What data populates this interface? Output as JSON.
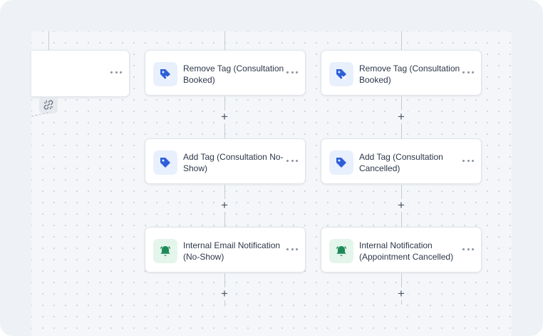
{
  "colors": {
    "frame_background": "#eef1f5",
    "canvas_background": "#f4f6f9",
    "tag_icon_color": "#2f5fd8",
    "tag_icon_background": "#e8f0fd",
    "bell_icon_color": "#1f8a58",
    "bell_icon_background": "#e4f5ec"
  },
  "workflow": {
    "add_step_symbol": "+",
    "columns": [
      {
        "nodes": [
          {
            "label": "",
            "icon": "none"
          }
        ]
      },
      {
        "nodes": [
          {
            "label": "Remove Tag (Consultation Booked)",
            "icon": "tag-remove-icon"
          },
          {
            "label": "Add Tag (Consultation No-Show)",
            "icon": "tag-icon"
          },
          {
            "label": "Internal Email Notification (No-Show)",
            "icon": "bell-icon"
          }
        ]
      },
      {
        "nodes": [
          {
            "label": "Remove Tag (Consultation Booked)",
            "icon": "tag-remove-icon"
          },
          {
            "label": "Add Tag (Consultation Cancelled)",
            "icon": "tag-icon"
          },
          {
            "label": "Internal Notification (Appointment Cancelled)",
            "icon": "bell-icon"
          }
        ]
      }
    ]
  }
}
